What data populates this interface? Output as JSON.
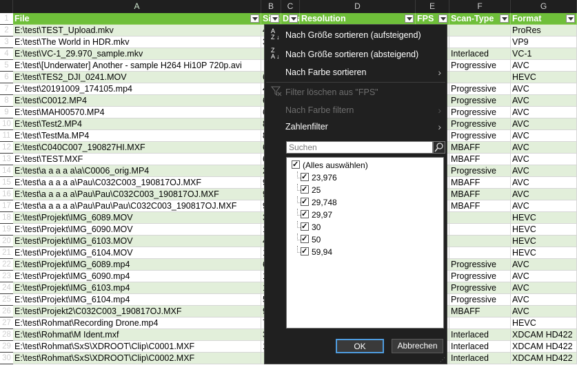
{
  "columns": [
    "A",
    "B",
    "C",
    "D",
    "E",
    "F",
    "G"
  ],
  "headers": [
    "File",
    "Size",
    "Duration",
    "Resolution",
    "FPS",
    "Scan-Type",
    "Format"
  ],
  "row_numbers": [
    "1",
    "2",
    "3",
    "4",
    "5",
    "6",
    "7",
    "8",
    "9",
    "10",
    "11",
    "12",
    "13",
    "14",
    "15",
    "16",
    "17",
    "18",
    "19",
    "20",
    "21",
    "22",
    "23",
    "24",
    "25",
    "26",
    "27",
    "28",
    "29",
    "30"
  ],
  "rows": [
    {
      "file": "E:\\test\\TEST_Upload.mkv",
      "size": "4",
      "scan": "",
      "format": "ProRes"
    },
    {
      "file": "E:\\test\\The World in HDR.mkv",
      "size": "3",
      "scan": "",
      "format": "VP9"
    },
    {
      "file": "E:\\test\\VC-1_29.970_sample.mkv",
      "size": "",
      "scan": "Interlaced",
      "format": "VC-1"
    },
    {
      "file": "E:\\test\\[Underwater] Another - sample H264 Hi10P 720p.avi",
      "size": "",
      "scan": "Progressive",
      "format": "AVC"
    },
    {
      "file": "E:\\test\\TES2_DJI_0241.MOV",
      "size": "6",
      "scan": "",
      "format": "HEVC"
    },
    {
      "file": "E:\\test\\20191009_174105.mp4",
      "size": "4",
      "scan": "Progressive",
      "format": "AVC"
    },
    {
      "file": "E:\\test\\C0012.MP4",
      "size": "6",
      "scan": "Progressive",
      "format": "AVC"
    },
    {
      "file": "E:\\test\\MAH00570.MP4",
      "size": "6",
      "scan": "Progressive",
      "format": "AVC"
    },
    {
      "file": "E:\\test\\Test2.MP4",
      "size": "8",
      "scan": "Progressive",
      "format": "AVC"
    },
    {
      "file": "E:\\test\\TestMa.MP4",
      "size": "8",
      "scan": "Progressive",
      "format": "AVC"
    },
    {
      "file": "E:\\test\\C040C007_190827HI.MXF",
      "size": "6",
      "scan": "MBAFF",
      "format": "AVC"
    },
    {
      "file": "E:\\test\\TEST.MXF",
      "size": "6",
      "scan": "MBAFF",
      "format": "AVC"
    },
    {
      "file": "E:\\test\\a a a a a\\a\\C0006_orig.MP4",
      "size": "2",
      "scan": "Progressive",
      "format": "AVC"
    },
    {
      "file": "E:\\test\\a a a a a\\Pau\\C032C003_190817OJ.MXF",
      "size": "9",
      "scan": "MBAFF",
      "format": "AVC"
    },
    {
      "file": "E:\\test\\a a a a a\\Pau\\Pau\\C032C003_190817OJ.MXF",
      "size": "9",
      "scan": "MBAFF",
      "format": "AVC"
    },
    {
      "file": "E:\\test\\a a a a a\\Pau\\Pau\\Pau\\C032C003_190817OJ.MXF",
      "size": "9",
      "scan": "MBAFF",
      "format": "AVC"
    },
    {
      "file": "E:\\test\\Projekt\\IMG_6089.MOV",
      "size": "3",
      "scan": "",
      "format": "HEVC"
    },
    {
      "file": "E:\\test\\Projekt\\IMG_6090.MOV",
      "size": "1",
      "scan": "",
      "format": "HEVC"
    },
    {
      "file": "E:\\test\\Projekt\\IMG_6103.MOV",
      "size": "4",
      "scan": "",
      "format": "HEVC"
    },
    {
      "file": "E:\\test\\Projekt\\IMG_6104.MOV",
      "size": "1",
      "scan": "",
      "format": "HEVC"
    },
    {
      "file": "E:\\test\\Projekt\\IMG_6089.mp4",
      "size": "6",
      "scan": "Progressive",
      "format": "AVC"
    },
    {
      "file": "E:\\test\\Projekt\\IMG_6090.mp4",
      "size": "1",
      "scan": "Progressive",
      "format": "AVC"
    },
    {
      "file": "E:\\test\\Projekt\\IMG_6103.mp4",
      "size": "1",
      "scan": "Progressive",
      "format": "AVC"
    },
    {
      "file": "E:\\test\\Projekt\\IMG_6104.mp4",
      "size": "5",
      "scan": "Progressive",
      "format": "AVC"
    },
    {
      "file": "E:\\test\\Projekt2\\C032C003_190817OJ.MXF",
      "size": "9",
      "scan": "MBAFF",
      "format": "AVC"
    },
    {
      "file": "E:\\test\\Rohmat\\Recording Drone.mp4",
      "size": "7",
      "scan": "",
      "format": "HEVC"
    },
    {
      "file": "E:\\test\\Rohmat\\M Ident.mxf",
      "size": "3",
      "scan": "Interlaced",
      "format": "XDCAM HD422"
    },
    {
      "file": "E:\\test\\Rohmat\\SxS\\XDROOT\\Clip\\C0001.MXF",
      "size": "1",
      "scan": "Interlaced",
      "format": "XDCAM HD422"
    },
    {
      "file": "E:\\test\\Rohmat\\SxS\\XDROOT\\Clip\\C0002.MXF",
      "size": "",
      "scan": "Interlaced",
      "format": "XDCAM HD422"
    }
  ],
  "menu": {
    "sort_asc_icon": "A\nZ",
    "sort_asc": "Nach Größe sortieren (aufsteigend)",
    "sort_desc_icon": "Z\nA",
    "sort_desc": "Nach Größe sortieren (absteigend)",
    "sort_color": "Nach Farbe sortieren",
    "clear_filter": "Filter löschen aus \"FPS\"",
    "filter_color": "Nach Farbe filtern",
    "number_filter": "Zahlenfilter",
    "search_placeholder": "Suchen",
    "items": [
      "(Alles auswählen)",
      "23,976",
      "25",
      "29,748",
      "29,97",
      "30",
      "50",
      "59,94"
    ],
    "ok": "OK",
    "cancel": "Abbrechen"
  }
}
